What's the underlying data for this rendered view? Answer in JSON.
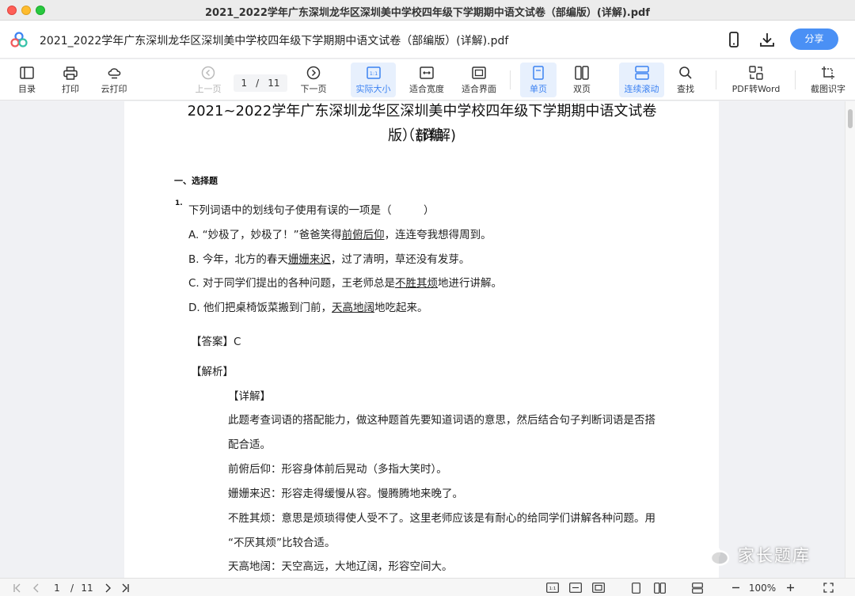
{
  "window": {
    "title": "2021_2022学年广东深圳龙华区深圳美中学校四年级下学期期中语文试卷（部编版）(详解).pdf"
  },
  "header": {
    "doc_title": "2021_2022学年广东深圳龙华区深圳美中学校四年级下学期期中语文试卷（部编版）(详解).pdf",
    "share_label": "分享",
    "icons": [
      "phone-icon",
      "download-icon"
    ]
  },
  "toolbar": {
    "toc": "目录",
    "print": "打印",
    "cloud_print": "云打印",
    "prev_page": "上一页",
    "current_page": "1",
    "page_sep": "/",
    "total_pages": "11",
    "next_page": "下一页",
    "actual_size": "实际大小",
    "fit_width": "适合宽度",
    "fit_page": "适合界面",
    "single_page": "单页",
    "double_page": "双页",
    "continuous_scroll": "连续滚动",
    "search": "查找",
    "pdf_to_word": "PDF转Word",
    "ocr": "截图识字",
    "accent_color": "#3c82f2"
  },
  "document": {
    "title_line1": "2021~2022学年广东深圳龙华区深圳美中学校四年级下学期期中语文试卷（部编",
    "title_line2": "版）(详解)",
    "section": "一、选择题",
    "question_number": "1.",
    "question": "下列词语中的划线句子使用有误的一项是（　　　）",
    "option_a": {
      "pre": "A. “妙极了，妙极了！”爸爸笑得",
      "underlined": "前俯后仰",
      "post": "，连连夸我想得周到。"
    },
    "option_b": {
      "pre": "B. 今年，北方的春天",
      "underlined": "姗姗来迟",
      "post": "，过了清明，草还没有发芽。"
    },
    "option_c": {
      "pre": "C. 对于同学们提出的各种问题，王老师总是",
      "underlined": "不胜其烦",
      "post": "地进行讲解。"
    },
    "option_d": {
      "pre": "D. 他们把桌椅饭菜搬到门前，",
      "underlined": "天高地阔",
      "post": "地吃起来。"
    },
    "answer_label": "【答案】",
    "answer_value": "C",
    "analysis_label": "【解析】",
    "detail_label": "【详解】",
    "detail_line1": "此题考查词语的搭配能力，做这种题首先要知道词语的意思，然后结合句子判断词语是否搭",
    "detail_line2": "配合适。",
    "detail_line3": "前俯后仰：形容身体前后晃动（多指大笑时）。",
    "detail_line4": "姗姗来迟：形容走得缓慢从容。慢腾腾地来晚了。",
    "detail_line5": "不胜其烦：意思是烦琐得使人受不了。这里老师应该是有耐心的给同学们讲解各种问题。用",
    "detail_line6": "“不厌其烦”比较合适。",
    "detail_line7": "天高地阔：天空高远，大地辽阔，形容空间大。"
  },
  "watermark": {
    "text": "家长题库"
  },
  "statusbar": {
    "current_page": "1",
    "page_sep": "/",
    "total_pages": "11",
    "zoom": "100%"
  }
}
